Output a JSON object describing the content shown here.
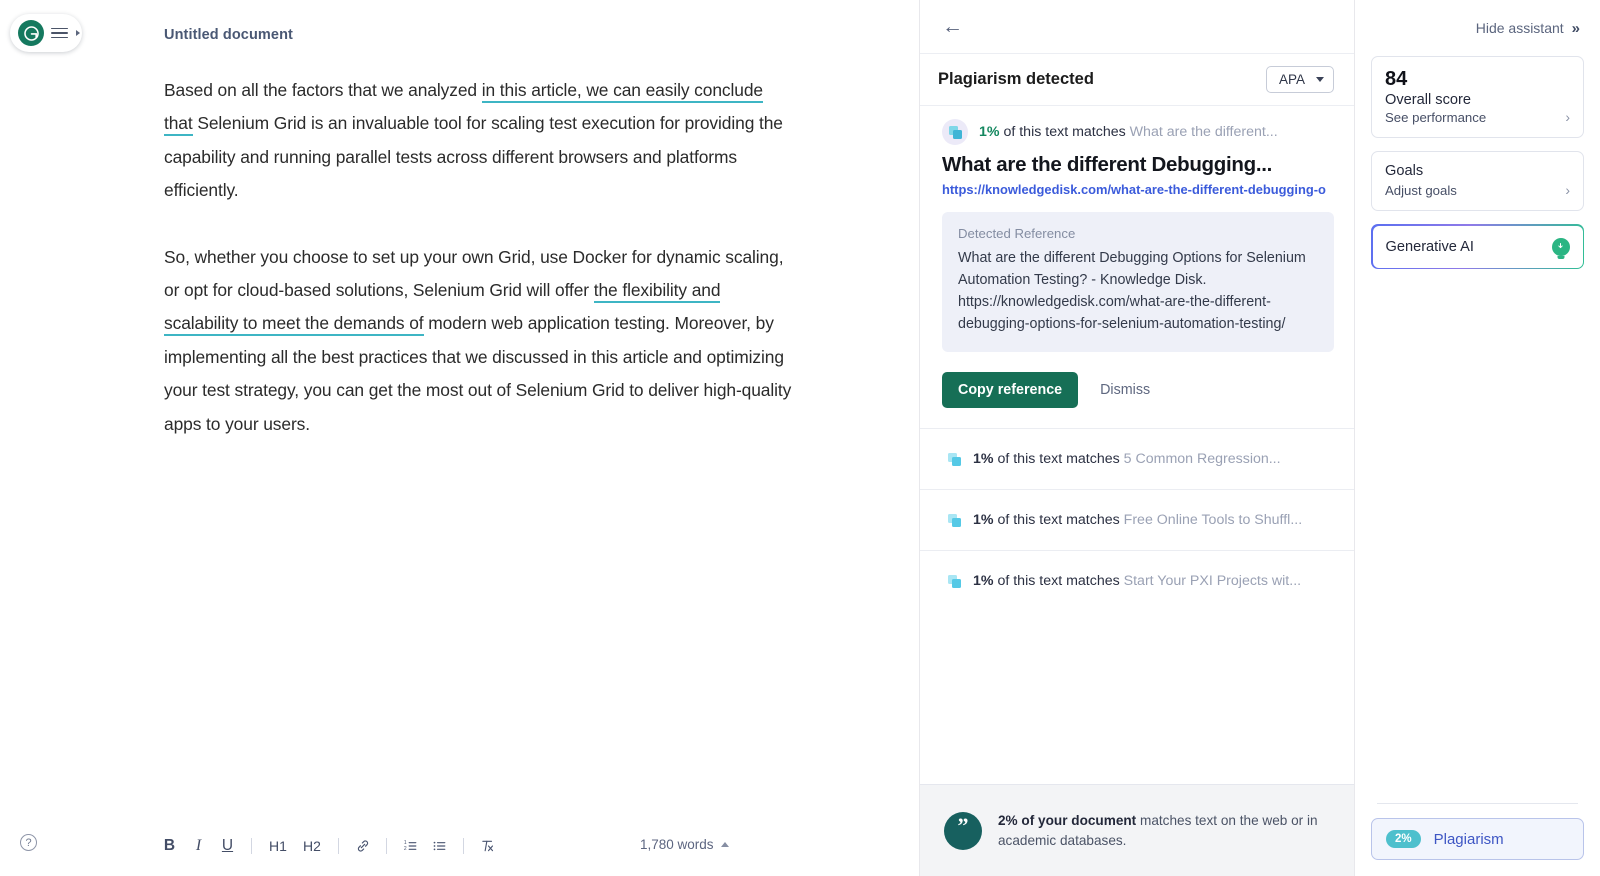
{
  "brand": {
    "logo_letter": "G",
    "menu_icon": "hamburger-icon"
  },
  "editor": {
    "document_title": "Untitled document",
    "paragraphs": [
      {
        "segments": [
          {
            "text": "Based on all the factors that we analyzed ",
            "underlined": false
          },
          {
            "text": "in this article, we can easily conclude that",
            "underlined": true
          },
          {
            "text": " Selenium Grid is an invaluable tool for scaling test execution for providing the capability and running parallel tests across different browsers and platforms efficiently.",
            "underlined": false
          }
        ]
      },
      {
        "segments": [
          {
            "text": "So, whether you choose to set up your own Grid, use Docker for dynamic scaling, or opt for cloud-based solutions, Selenium Grid will offer ",
            "underlined": false
          },
          {
            "text": "the flexibility and scalability to meet the demands of",
            "underlined": true
          },
          {
            "text": " modern web application testing. Moreover, by implementing all the best practices that we discussed in this article and optimizing your test strategy, you can get the most out of Selenium Grid to deliver high-quality apps to your users.",
            "underlined": false
          }
        ]
      }
    ],
    "toolbar": {
      "bold": "B",
      "italic": "I",
      "underline": "U",
      "heading1": "H1",
      "heading2": "H2",
      "link_icon": "link-icon",
      "numbered_list_icon": "numbered-list-icon",
      "bullet_list_icon": "bullet-list-icon",
      "clear_format_icon": "clear-formatting-icon"
    },
    "word_count": "1,780 words",
    "help_label": "?"
  },
  "plagiarism": {
    "back_label": "←",
    "title": "Plagiarism detected",
    "style_selector": {
      "value": "APA"
    },
    "active_match": {
      "percent": "1%",
      "match_prefix": "of this text matches",
      "source_short": "What are the different...",
      "title": "What are the different Debugging...",
      "url": "https://knowledgedisk.com/what-are-the-different-debugging-o",
      "reference_label": "Detected Reference",
      "reference_text": "What are the different Debugging Options for Selenium Automation Testing? - Knowledge Disk. https://knowledgedisk.com/what-are-the-different-debugging-options-for-selenium-automation-testing/",
      "copy_label": "Copy reference",
      "dismiss_label": "Dismiss"
    },
    "other_matches": [
      {
        "percent": "1%",
        "match_prefix": "of this text matches",
        "source": "5 Common Regression..."
      },
      {
        "percent": "1%",
        "match_prefix": "of this text matches",
        "source": "Free Online Tools to Shuffl..."
      },
      {
        "percent": "1%",
        "match_prefix": "of this text matches",
        "source": "Start Your PXI Projects wit..."
      }
    ],
    "footer": {
      "icon": "quote-icon",
      "bold_part": "2% of your document",
      "rest_part": " matches text on the web or in academic databases."
    }
  },
  "assistant": {
    "hide_label": "Hide assistant",
    "score_card": {
      "score": "84",
      "title": "Overall score",
      "subtitle": "See performance"
    },
    "goals_card": {
      "title": "Goals",
      "subtitle": "Adjust goals"
    },
    "generative_ai": {
      "label": "Generative AI",
      "icon": "lightbulb-icon"
    },
    "plagiarism_badge": {
      "percent": "2%",
      "label": "Plagiarism"
    }
  },
  "colors": {
    "brand_green": "#15795f",
    "underline_teal": "#3eb5c4",
    "link_blue": "#3b5bdb",
    "accent_green": "#14875f",
    "badge_teal": "#4ec0cd"
  }
}
